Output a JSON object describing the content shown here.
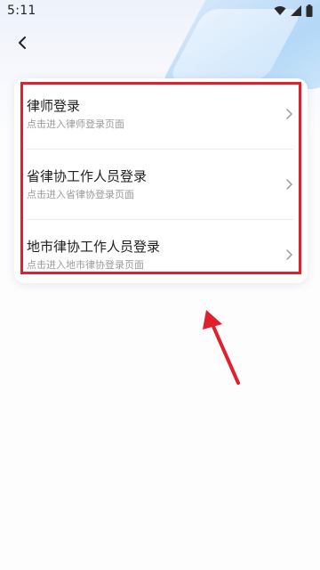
{
  "status_bar": {
    "time": "5:11"
  },
  "header": {
    "back_icon": "chevron-left-icon"
  },
  "login_menu": {
    "items": [
      {
        "title": "律师登录",
        "subtitle": "点击进入律师登录页面"
      },
      {
        "title": "省律协工作人员登录",
        "subtitle": "点击进入省律协登录页面"
      },
      {
        "title": "地市律协工作人员登录",
        "subtitle": "点击进入地市律协登录页面"
      }
    ]
  },
  "colors": {
    "highlight": "#e0202c",
    "title_text": "#1f1f1f",
    "subtitle_text": "#9a9a9a",
    "accent_blue": "#a9d3f6"
  }
}
